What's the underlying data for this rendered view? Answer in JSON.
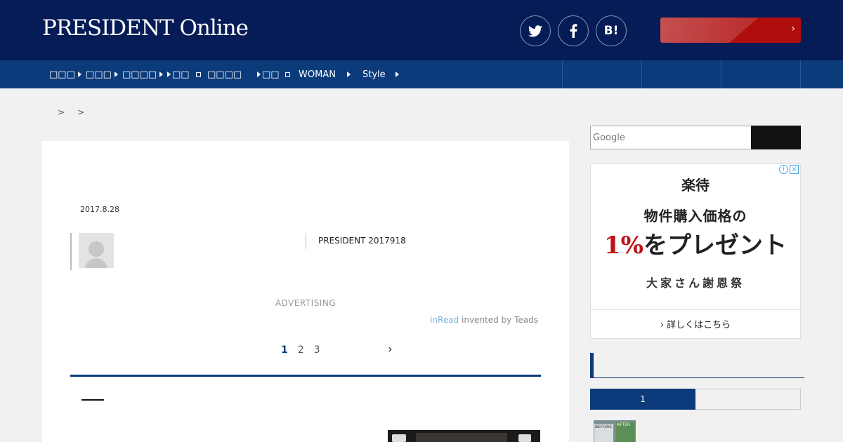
{
  "header": {
    "logo": "PRESIDENT Online",
    "social": {
      "twitter_glyph": "t",
      "facebook_glyph": "f",
      "hatena_label": "B!"
    },
    "cta_arrow": "›",
    "colors": {
      "header_bg": "#061c56",
      "nav_bg": "#0c3b7c",
      "cta_red": "#b00d0d"
    }
  },
  "nav": {
    "items": [
      {
        "label": "□□□"
      },
      {
        "label": "□□□"
      },
      {
        "label": "□□□□"
      },
      {
        "label": "□□"
      },
      {
        "label": "□□□□"
      },
      {
        "label": "□□"
      },
      {
        "label": "WOMAN"
      },
      {
        "label": "Style"
      }
    ]
  },
  "breadcrumb": {
    "sep1": ">",
    "sep2": ">"
  },
  "article": {
    "date": "2017.8.28",
    "source": "PRESIDENT 2017918",
    "advertising": "ADVERTISING",
    "teads_brand": "inRead",
    "teads_text": " invented by Teads",
    "pages": [
      "1",
      "2",
      "3"
    ],
    "next_glyph": "›"
  },
  "sidebar": {
    "search_placeholder": "Google",
    "ad": {
      "brand": "楽待",
      "line1": "物件購入価格の",
      "line2_red": "1%",
      "line2_rest": "をプレゼント",
      "line3": "大家さん謝恩祭",
      "cta": "詳しくはこちら",
      "info_glyph": "i",
      "close_glyph": "×"
    },
    "ranking": {
      "tabs": [
        {
          "label": "1"
        },
        {
          "label": ""
        }
      ],
      "thumb_before": "BEFORE",
      "thumb_after": "AFTER"
    }
  }
}
